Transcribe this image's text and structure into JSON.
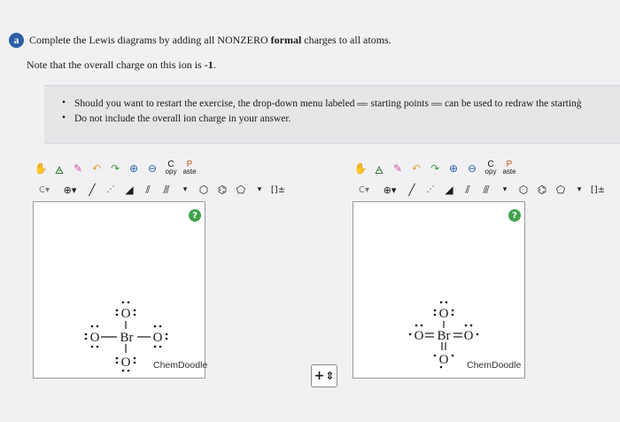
{
  "question": {
    "badge": "a",
    "instruction_pre": "Complete the Lewis diagrams by adding all NONZERO ",
    "instruction_bold": "formal",
    "instruction_post": " charges to all atoms.",
    "note_pre": "Note that the overall charge on this ion is ",
    "note_bold": "-1",
    "note_post": "."
  },
  "info": {
    "line1_pre": "Should you want to restart the exercise, the drop-down menu labeled",
    "line1_mid": "starting points",
    "line1_post": "can be used to redraw the startinģ",
    "line2": "Do not include the overall ion charge in your answer."
  },
  "toolbar": {
    "copy_top": "C",
    "copy_bottom": "opy",
    "paste_top": "P",
    "paste_bottom": "aste",
    "charge_dropdown": "C",
    "add_button": "⊕",
    "bracket": "[]±"
  },
  "editors": [
    {
      "help": "?",
      "brand": "ChemDoodle",
      "atoms": [
        "O",
        "O",
        "Br",
        "O",
        "O"
      ]
    },
    {
      "help": "?",
      "brand": "ChemDoodle",
      "atoms": [
        "O",
        "O",
        "Br",
        "O",
        "O"
      ]
    }
  ],
  "zoom": {
    "plus": "+",
    "arrows": "⇕"
  }
}
